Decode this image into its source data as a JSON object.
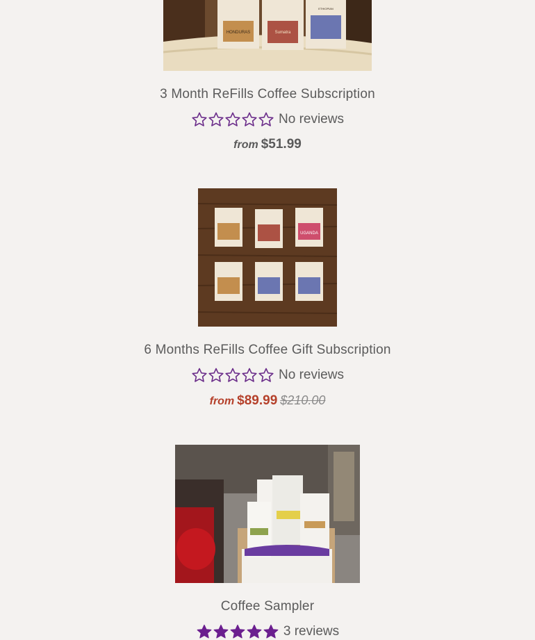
{
  "colors": {
    "background": "#f4f2f0",
    "text": "#5b5b5b",
    "sale_price": "#b5402a",
    "star_empty": "#6b2d8a",
    "star_filled": "#6b1f8f"
  },
  "products": [
    {
      "title": "3 Month ReFills Coffee Subscription",
      "image_icon": "coffee-bags-on-burlap-image",
      "stars_filled": 0,
      "stars_total": 5,
      "reviews_label": "No reviews",
      "price_prefix": "from",
      "price": "$51.99",
      "compare_price": ""
    },
    {
      "title": "6 Months ReFills Coffee Gift Subscription",
      "image_icon": "six-coffee-bags-on-wood-image",
      "stars_filled": 0,
      "stars_total": 5,
      "reviews_label": "No reviews",
      "price_prefix": "from",
      "price": "$89.99",
      "compare_price": "$210.00"
    },
    {
      "title": "Coffee Sampler",
      "image_icon": "coffee-sampler-box-image",
      "stars_filled": 5,
      "stars_total": 5,
      "reviews_label": "3 reviews",
      "price_prefix": "",
      "price": "",
      "compare_price": ""
    }
  ],
  "bag_labels": {
    "honduras": "HONDURAS",
    "sumatra": "Sumatra",
    "ethiopian": "ETHIOPIAN YIRGACHEFFE",
    "uganda": "UGANDA"
  }
}
